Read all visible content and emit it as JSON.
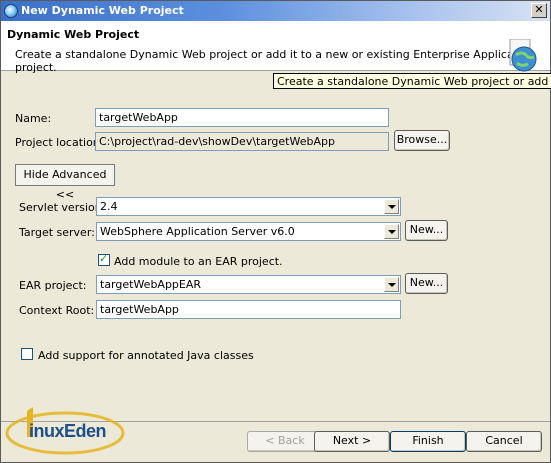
{
  "window": {
    "title": "New Dynamic Web Project",
    "close_label": "✕"
  },
  "header": {
    "title": "Dynamic Web Project",
    "description": "Create a standalone Dynamic Web project or add it to a new or existing Enterprise Application project."
  },
  "tooltip": {
    "text": "Create a standalone Dynamic Web project or add it to a new"
  },
  "form": {
    "name_label": "Name:",
    "name_value": "targetWebApp",
    "location_label": "Project location:",
    "location_value": "C:\\project\\rad-dev\\showDev\\targetWebApp",
    "browse_label": "Browse...",
    "hide_advanced_label": "Hide Advanced <<",
    "servlet_label": "Servlet version:",
    "servlet_value": "2.4",
    "target_label": "Target server:",
    "target_value": "WebSphere Application Server v6.0",
    "new_server_label": "New...",
    "add_ear_label": "Add module to an EAR project.",
    "add_ear_checked": true,
    "ear_label": "EAR project:",
    "ear_value": "targetWebAppEAR",
    "new_ear_label": "New...",
    "context_label": "Context Root:",
    "context_value": "targetWebApp",
    "annotated_label": "Add support for annotated Java classes",
    "annotated_checked": false
  },
  "buttons": {
    "back": "< Back",
    "next": "Next >",
    "finish": "Finish",
    "cancel": "Cancel"
  },
  "watermark": {
    "text": "inuxEden"
  }
}
